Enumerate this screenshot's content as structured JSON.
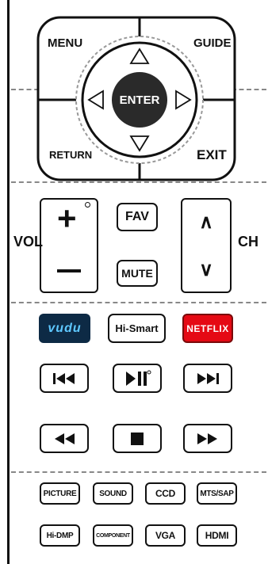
{
  "dpad": {
    "menu": "MENU",
    "guide": "GUIDE",
    "return": "RETURN",
    "exit": "EXIT",
    "enter": "ENTER"
  },
  "volume": {
    "label": "VOL",
    "plus": "+",
    "minus": "–"
  },
  "channel": {
    "label": "CH",
    "up": "∧",
    "down": "∨"
  },
  "center": {
    "fav": "FAV",
    "mute": "MUTE"
  },
  "apps": {
    "vudu": "vudu",
    "hismart": "Hi-Smart",
    "netflix": "NETFLIX"
  },
  "inputs": {
    "row1": [
      "PICTURE",
      "SOUND",
      "CCD",
      "MTS/SAP"
    ],
    "row2": [
      "Hi-DMP",
      "COMPONENT",
      "VGA",
      "HDMI"
    ]
  },
  "colors": {
    "netflix": "#e50914",
    "vudu": "#0d2a45",
    "vudu_text": "#5ec8ff",
    "enter": "#2a2a2a"
  }
}
